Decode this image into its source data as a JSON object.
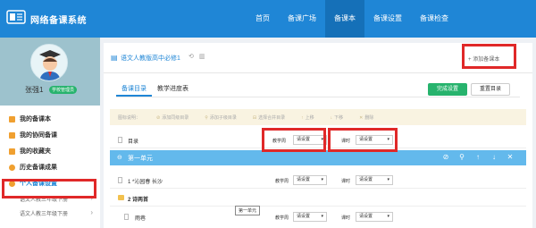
{
  "app": {
    "title": "网络备课系统",
    "nav": [
      "首页",
      "备课广场",
      "备课本",
      "备课设置",
      "备课检查"
    ],
    "active_nav_index": 2
  },
  "user": {
    "name": "张强1",
    "role_badge": "学校管理员"
  },
  "sidebar": {
    "items": [
      {
        "label": "我的备课本"
      },
      {
        "label": "我的协同备课"
      },
      {
        "label": "我的收藏夹"
      },
      {
        "label": "历史备课成果"
      },
      {
        "label": "个人备课设置"
      }
    ],
    "sub_items": [
      {
        "label": "语文人教三年级下册"
      },
      {
        "label": "语文人教三年级下册"
      }
    ]
  },
  "book": {
    "tab_label": "语文人教版高中必修1",
    "add_book_label": "添加备课本"
  },
  "tabs": {
    "items": [
      "备课目录",
      "教学进度表"
    ],
    "complete_button": "完成设置",
    "reset_button": "重置目录"
  },
  "toolbar": {
    "hint": "图标说明：",
    "items": [
      {
        "icon": "link-icon",
        "label": "添加同级目录"
      },
      {
        "icon": "branch-icon",
        "label": "添加子级目录"
      },
      {
        "icon": "merge-icon",
        "label": "选择合并目录"
      },
      {
        "icon": "arrow-up-icon",
        "label": "上移"
      },
      {
        "icon": "arrow-down-icon",
        "label": "下移"
      },
      {
        "icon": "delete-icon",
        "label": "删除"
      }
    ]
  },
  "rows": {
    "catalog": {
      "label": "目录",
      "week_label": "教学周",
      "week_value": "请设置",
      "hours_label": "课时",
      "hours_value": "请设置"
    },
    "unit": {
      "label": "第一单元",
      "tooltip": "第一单元"
    },
    "lesson1": {
      "label": "1 *沁园春 长沙",
      "week_label": "教学周",
      "week_value": "请设置",
      "hours_label": "课时",
      "hours_value": "请设置"
    },
    "group": {
      "label": "2 诗两首"
    },
    "lesson2": {
      "label": "雨巷",
      "week_label": "教学周",
      "week_value": "请设置",
      "hours_label": "课时",
      "hours_value": "请设置"
    }
  },
  "colors": {
    "brand": "#1f86d6",
    "unit_row": "#63b9ec",
    "green": "#27b36d",
    "highlight": "#e02828"
  }
}
